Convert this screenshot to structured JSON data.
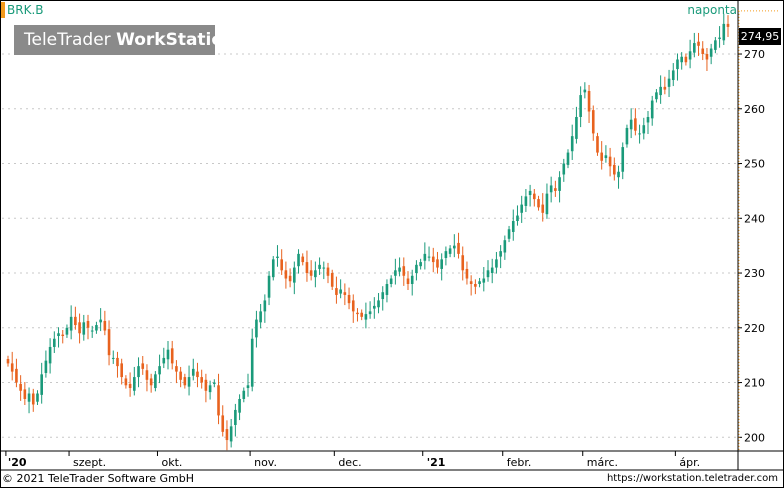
{
  "symbol": "BRK.B",
  "period_label": "naponta",
  "watermark": {
    "brand": "TeleTrader",
    "product": "WorkStation"
  },
  "footer": {
    "copyright": "© 2021 TeleTrader Software GmbH",
    "url": "https://workstation.teletrader.com"
  },
  "colors": {
    "up": "#1a9a7a",
    "down": "#e8621e",
    "accent": "#f39a1c",
    "grid": "#c8c8c8"
  },
  "chart_data": {
    "type": "candlestick",
    "last_value_label": "274,95",
    "ylim": [
      197.5,
      279.5
    ],
    "y_ticks": [
      200,
      210,
      220,
      230,
      240,
      250,
      260,
      270
    ],
    "y_tick_labels": [
      "200",
      "210",
      "220",
      "230",
      "240",
      "250",
      "260",
      "270"
    ],
    "x_labels": [
      {
        "text": "'20",
        "idx": 0
      },
      {
        "text": "szept.",
        "idx": 15
      },
      {
        "text": "okt.",
        "idx": 36
      },
      {
        "text": "nov.",
        "idx": 58
      },
      {
        "text": "dec.",
        "idx": 78
      },
      {
        "text": "'21",
        "idx": 99
      },
      {
        "text": "febr.",
        "idx": 118
      },
      {
        "text": "márc.",
        "idx": 137
      },
      {
        "text": "ápr.",
        "idx": 159
      }
    ],
    "closes": [
      213.5,
      212.0,
      210.0,
      208.5,
      207.0,
      208.0,
      206.0,
      208.0,
      211.5,
      214.0,
      216.5,
      218.0,
      219.0,
      218.5,
      220.0,
      222.0,
      220.5,
      219.0,
      221.0,
      220.0,
      219.5,
      220.5,
      221.5,
      219.5,
      215.0,
      214.5,
      213.0,
      211.0,
      209.5,
      209.0,
      211.0,
      213.0,
      212.5,
      210.5,
      209.5,
      211.5,
      213.0,
      214.5,
      216.0,
      213.5,
      212.0,
      210.5,
      209.5,
      211.0,
      212.5,
      211.0,
      210.0,
      208.5,
      209.5,
      210.0,
      204.0,
      201.0,
      199.5,
      202.0,
      205.0,
      207.0,
      208.5,
      209.5,
      218.0,
      221.5,
      223.0,
      225.0,
      229.5,
      232.5,
      233.0,
      230.5,
      229.0,
      228.5,
      231.0,
      233.5,
      232.0,
      230.0,
      229.5,
      230.5,
      231.5,
      231.0,
      229.5,
      227.5,
      226.0,
      227.0,
      226.0,
      224.5,
      223.0,
      222.5,
      222.0,
      222.5,
      223.0,
      224.0,
      225.0,
      226.5,
      228.0,
      229.0,
      230.5,
      231.0,
      229.5,
      228.0,
      229.5,
      231.5,
      232.0,
      233.5,
      233.0,
      232.0,
      231.0,
      232.5,
      234.0,
      234.5,
      235.0,
      233.5,
      230.5,
      229.0,
      228.0,
      227.5,
      228.5,
      229.0,
      230.5,
      231.0,
      232.5,
      234.0,
      236.0,
      238.0,
      239.5,
      240.5,
      242.5,
      244.0,
      245.0,
      243.5,
      242.0,
      241.0,
      244.5,
      246.0,
      245.0,
      247.5,
      250.0,
      252.0,
      255.0,
      258.5,
      262.5,
      263.5,
      259.5,
      255.5,
      252.0,
      250.5,
      251.5,
      249.5,
      248.0,
      248.5,
      253.0,
      256.5,
      258.0,
      256.0,
      255.5,
      257.0,
      258.5,
      261.5,
      263.0,
      264.0,
      263.5,
      265.5,
      267.0,
      269.0,
      269.5,
      268.5,
      270.5,
      272.0,
      271.5,
      270.0,
      269.0,
      271.0,
      272.5,
      273.0,
      275.5,
      274.95
    ]
  }
}
